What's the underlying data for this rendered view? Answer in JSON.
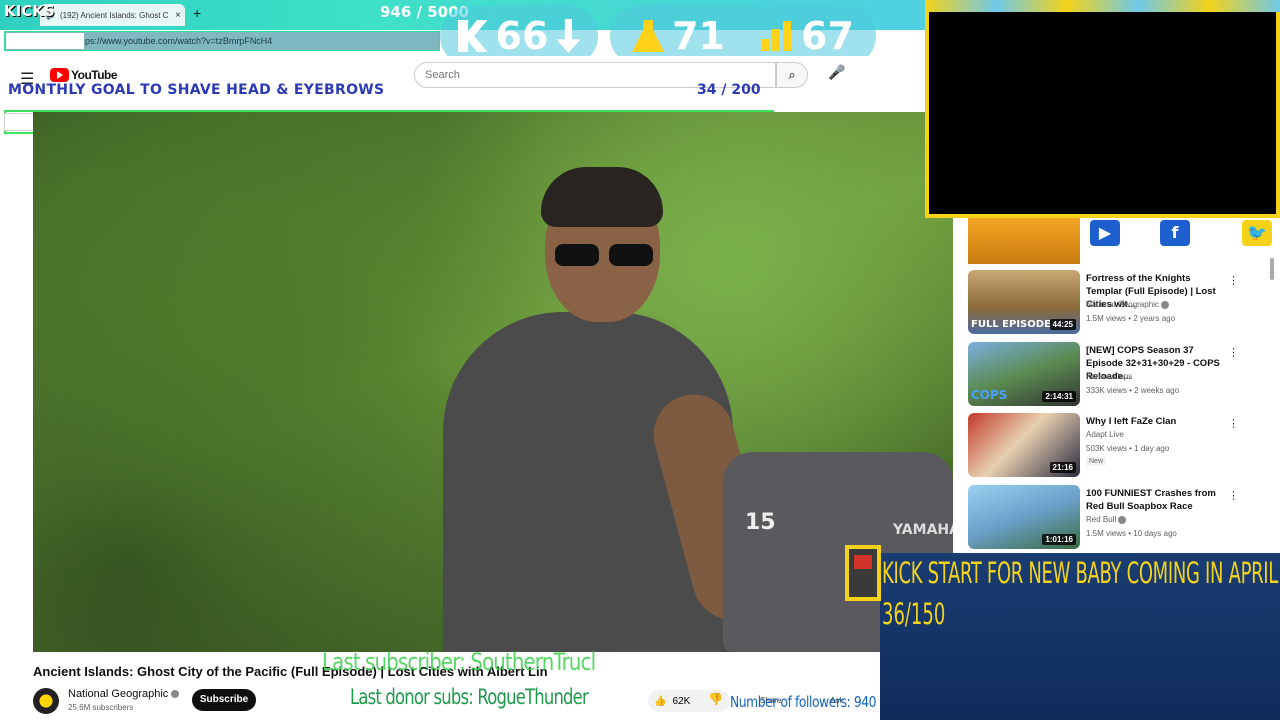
{
  "browser": {
    "tab_title": "(192) Ancient Islands: Ghost C",
    "new_tab": "+",
    "close_tab": "×",
    "address": "ps://www.youtube.com/watch?v=tzBmrpFNcH4"
  },
  "overlay": {
    "kicks_label": "KICKS",
    "kicks_progress": "946  / 5000",
    "stat_kicks": "66",
    "stat_subs": "71",
    "stat_followers": "67",
    "goal_text": "MONTHLY GOAL TO SHAVE HEAD & EYEBROWS",
    "goal_count": "34   / 200",
    "goal_progress": 0.17,
    "last_subscriber": "Last subscriber: SouthernTrucl",
    "last_donor": "Last donor subs: RogueThunder",
    "followers": "Number of followers: 940",
    "kick_start_title": "KICK START FOR NEW BABY COMING IN APRIL",
    "kick_start_count": "36/150",
    "accent_yellow": "#f4d21a",
    "accent_green": "#39d04a"
  },
  "youtube": {
    "logo_text": "YouTube",
    "search_placeholder": "Search",
    "video_overlay_number": "15",
    "video_overlay_brand": "YAMAHA",
    "video_title": "Ancient Islands: Ghost City of the Pacific (Full Episode) | Lost Cities with Albert Lin",
    "channel_name": "National Geographic",
    "channel_subs": "25.6M subscribers",
    "subscribe_label": "Subscribe",
    "likes": "62K",
    "share_label": "Share",
    "clip_label": "Ask"
  },
  "recommendations": [
    {
      "title": "Fortress of the Knights Templar (Full Episode) | Lost Cities wit...",
      "channel": "National Geographic",
      "meta": "1.5M views • 2 years ago",
      "duration": "44:25",
      "badge": "FULL EPISODE"
    },
    {
      "title": "[NEW] COPS Season 37 Episode 32+31+30+29 - COPS Reloade...",
      "channel": "Karens Cops",
      "meta": "333K views • 2 weeks ago",
      "duration": "2:14:31",
      "badge": "COPS"
    },
    {
      "title": "Why I left FaZe Clan",
      "channel": "Adapt Live",
      "meta": "503K views • 1 day ago",
      "duration": "21:16",
      "badge": "",
      "new": "New"
    },
    {
      "title": "100 FUNNIEST Crashes from Red Bull Soapbox Race",
      "channel": "Red Bull",
      "meta": "1.5M views • 10 days ago",
      "duration": "1:01:16",
      "badge": ""
    }
  ]
}
